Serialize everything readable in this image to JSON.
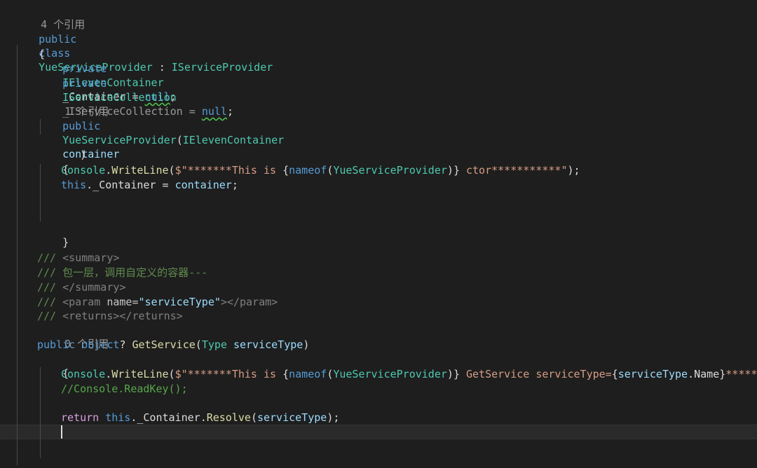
{
  "code": {
    "lens_class": "4 个引用",
    "class_kw1": "public",
    "class_kw2": "class",
    "class_name": "YueServiceProvider",
    "class_colon": " : ",
    "class_iface": "IServiceProvider",
    "brace_open": "{",
    "brace_close": "}",
    "field1_mod": "private",
    "field1_type": "IElevenContainer",
    "field1_name": "_Container",
    "field1_eq": " = ",
    "field1_null": "null",
    "semicolon": ";",
    "field2_mod": "private",
    "field2_type": "IServiceCollection",
    "field2_name": "_IServiceCollection",
    "field2_null": "null",
    "lens_ctor": "1 个引用",
    "ctor_mod": "public",
    "ctor_name": "YueServiceProvider",
    "ctor_param_type": "IElevenContainer",
    "ctor_param_name": "container",
    "paren_open": "(",
    "paren_close": ")",
    "console": "Console",
    "dot": ".",
    "writeline": "WriteLine",
    "str_prefix": "$\"*******This is ",
    "brace_l": "{",
    "brace_r": "}",
    "nameof_kw": "nameof",
    "ctor_str_tail": " ctor***********\"",
    "stmt_end": ");",
    "this_kw": "this",
    "assign_lhs": "_Container",
    "assign_rhs": "container",
    "doc1_slashes": "/// ",
    "doc1_tag": "<summary>",
    "doc2_text": "/// 包一层，调用自定义的容器---",
    "doc3_tag": "</summary>",
    "doc4_open": "<param ",
    "doc4_attr": "name=",
    "doc4_val": "\"serviceType\"",
    "doc4_close": "></param>",
    "doc5_tag": "<returns></returns>",
    "lens_method": "0 个引用",
    "m_mod": "public",
    "m_ret": "object",
    "m_q": "? ",
    "m_name": "GetService",
    "m_param_type": "Type",
    "m_param_name": "serviceType",
    "gs_str_mid": " GetService serviceType=",
    "gs_prop": "serviceType",
    "gs_prop2": "Name",
    "gs_str_tail": "***********\"",
    "comment_line": "//Console.ReadKey();",
    "return_kw": "return",
    "resolve": "Resolve",
    "container_field": "_Container"
  }
}
